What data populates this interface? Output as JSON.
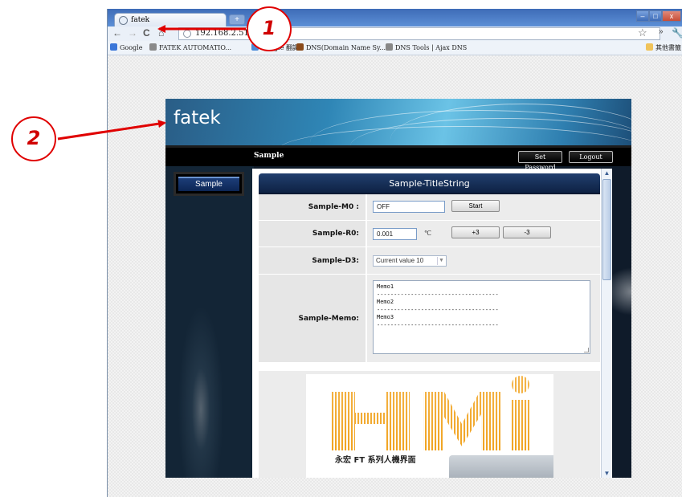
{
  "browser": {
    "tab_title": "fatek",
    "new_tab_label": "+",
    "window_buttons": [
      "–",
      "□",
      "x"
    ],
    "nav": {
      "back": "←",
      "forward": "→",
      "reload": "C",
      "home": "⌂"
    },
    "url": "192.168.2.51",
    "toolbar_icons": {
      "star": "☆",
      "more": "»",
      "wrench": "🔧"
    },
    "bookmarks": [
      {
        "label": "Google",
        "icon_color": "#3a76d8"
      },
      {
        "label": "FATEK AUTOMATIO...",
        "icon_color": "#8a8a8a"
      },
      {
        "label": "Google 翻譯",
        "icon_color": "#4a8ad8"
      },
      {
        "label": "DNS(Domain Name Sy...",
        "icon_color": "#8a4a1a"
      },
      {
        "label": "DNS Tools | Ajax DNS",
        "icon_color": "#888888"
      }
    ],
    "other_bookmarks": "其他書籤"
  },
  "page": {
    "logo": "fatek",
    "header_title": "Sample",
    "set_password_label": "Set Password",
    "logout_label": "Logout",
    "sidebar_button": "Sample",
    "content_title": "Sample-TitleString",
    "rows": {
      "m0": {
        "label": "Sample-M0 :",
        "value": "OFF",
        "button": "Start"
      },
      "r0": {
        "label": "Sample-R0:",
        "value": "0.001",
        "unit": "℃",
        "plus_button": "+3",
        "minus_button": "-3"
      },
      "d3": {
        "label": "Sample-D3:",
        "selected": "Current value 10"
      },
      "memo": {
        "label": "Sample-Memo:",
        "lines": [
          "Memo1",
          "------------------------------------",
          "Memo2",
          "------------------------------------",
          "Memo3",
          "------------------------------------"
        ]
      }
    },
    "hmi_logo_text": "HMi",
    "hmi_caption": "永宏 FT 系列人機界面"
  },
  "annotations": [
    {
      "number": "1"
    },
    {
      "number": "2"
    }
  ],
  "colors": {
    "annotation_red": "#e00000",
    "title_bar": "#16335f",
    "hmi_orange": "#f0a020"
  }
}
